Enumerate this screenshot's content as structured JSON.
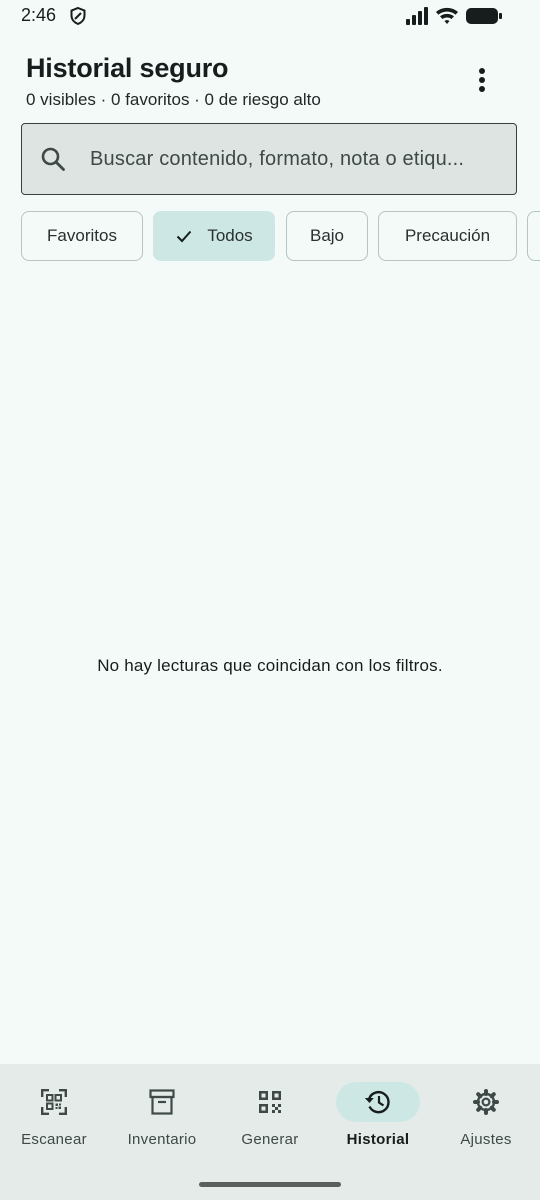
{
  "status_bar": {
    "time": "2:46",
    "icons": [
      "shield-icon",
      "signal-icon",
      "wifi-icon",
      "battery-icon"
    ]
  },
  "header": {
    "title": "Historial seguro",
    "subtitle": "0 visibles · 0 favoritos · 0 de riesgo alto",
    "menu_icon": "more-vert-icon"
  },
  "search": {
    "placeholder": "Buscar contenido, formato, nota o etiqu...",
    "value": "",
    "icon": "search-icon"
  },
  "filters": [
    {
      "label": "Favoritos",
      "selected": false
    },
    {
      "label": "Todos",
      "selected": true
    },
    {
      "label": "Bajo",
      "selected": false
    },
    {
      "label": "Precaución",
      "selected": false
    }
  ],
  "empty_state": {
    "message": "No hay lecturas que coincidan con los filtros."
  },
  "bottom_nav": {
    "items": [
      {
        "label": "Escanear",
        "icon": "qr-scan-icon",
        "active": false
      },
      {
        "label": "Inventario",
        "icon": "archive-box-icon",
        "active": false
      },
      {
        "label": "Generar",
        "icon": "qr-code-icon",
        "active": false
      },
      {
        "label": "Historial",
        "icon": "history-icon",
        "active": true
      },
      {
        "label": "Ajustes",
        "icon": "settings-gear-icon",
        "active": false
      }
    ]
  },
  "colors": {
    "background": "#f3faf8",
    "accent_container": "#cde8e4",
    "nav_background": "#e4ebe9",
    "search_background": "#dde4e2"
  }
}
